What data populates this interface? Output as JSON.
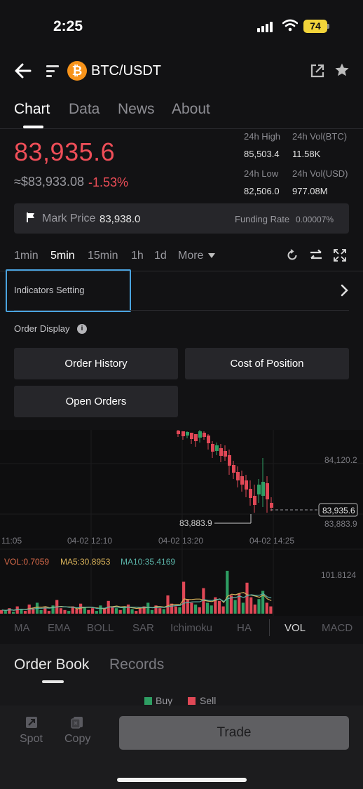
{
  "status": {
    "time": "2:25",
    "battery": "74"
  },
  "header": {
    "pair": "BTC/USDT",
    "coin_glyph": "₿"
  },
  "tabs": [
    "Chart",
    "Data",
    "News",
    "About"
  ],
  "price": {
    "last": "83,935.6",
    "usd": "≈$83,933.08",
    "change": "-1.53%",
    "high_label": "24h High",
    "high": "85,503.4",
    "vol_btc_label": "24h Vol(BTC)",
    "vol_btc": "11.58K",
    "low_label": "24h Low",
    "low": "82,506.0",
    "vol_usd_label": "24h Vol(USD)",
    "vol_usd": "977.08M"
  },
  "mark": {
    "label": "Mark Price",
    "value": "83,938.0",
    "funding_label": "Funding Rate",
    "funding_value": "0.00007%"
  },
  "intervals": [
    "1min",
    "5min",
    "15min",
    "1h",
    "1d"
  ],
  "interval_selected": "5min",
  "more_label": "More",
  "indicators_setting": "Indicators Setting",
  "order_display": {
    "label": "Order Display",
    "buttons": [
      "Order History",
      "Cost of Position",
      "Open Orders"
    ]
  },
  "chart": {
    "price_high_tick": "84,120.2",
    "current_price_tag": "83,935.6",
    "low_tick": "83,883.9",
    "low_marker": "83,883.9",
    "time_labels": [
      "11:05",
      "04-02 12:10",
      "04-02 13:20",
      "04-02 14:25"
    ],
    "vol_label": "VOL:0.7059",
    "ma5_label": "MA5:30.8953",
    "ma10_label": "MA10:35.4169",
    "vol_axis": "101.8124",
    "colors": {
      "up": "#2e9e63",
      "down": "#e04856",
      "ma5": "#d8b25a",
      "ma10": "#5ab3a8"
    }
  },
  "indicator_tabs": [
    "MA",
    "EMA",
    "BOLL",
    "SAR",
    "Ichimoku",
    "HA",
    "VOL",
    "MACD"
  ],
  "indicator_active": "VOL",
  "orderbook": {
    "tabs": [
      "Order Book",
      "Records"
    ],
    "buy": "Buy",
    "sell": "Sell"
  },
  "bottom": {
    "spot": "Spot",
    "copy": "Copy",
    "trade": "Trade"
  }
}
